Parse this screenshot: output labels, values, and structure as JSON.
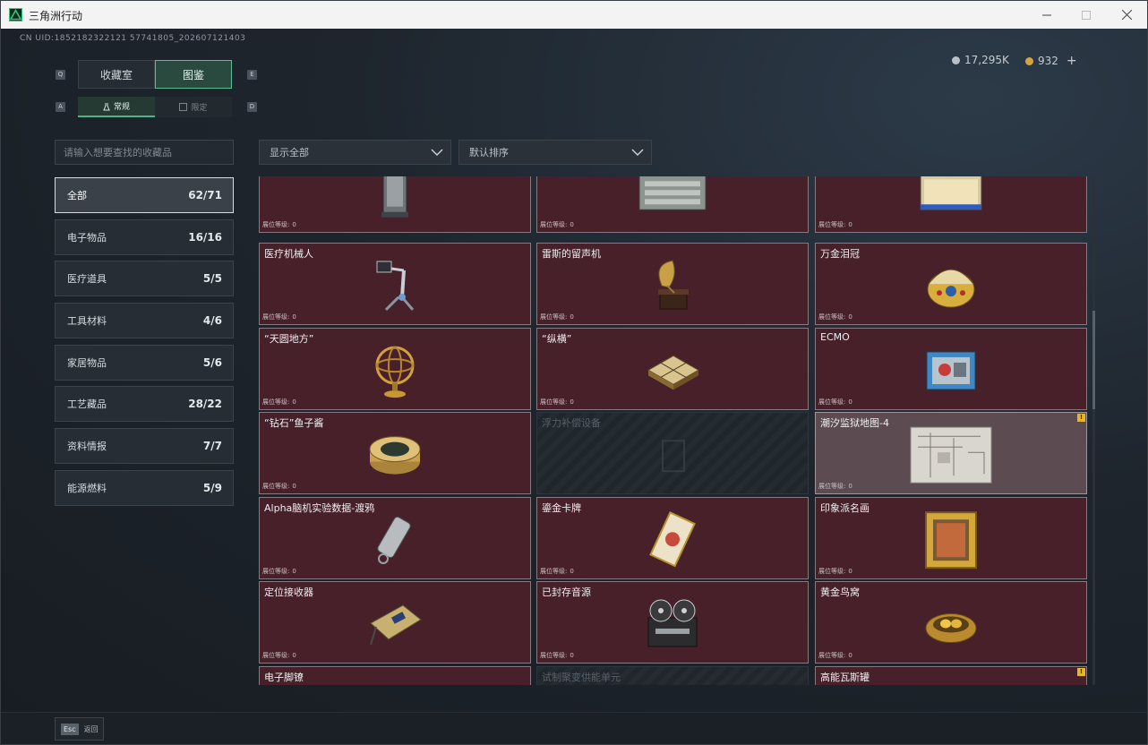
{
  "window": {
    "title": "三角洲行动"
  },
  "header": {
    "uid": "CN UID:1852182322121 57741805_202607121403",
    "currency_a": "17,295K",
    "currency_b": "932",
    "add_label": "+"
  },
  "tabs": {
    "left_key": "Q",
    "right_key": "E",
    "items": [
      {
        "label": "收藏室"
      },
      {
        "label": "图鉴"
      }
    ]
  },
  "subtabs": {
    "left_key": "A",
    "right_key": "D",
    "items": [
      {
        "label": "常规"
      },
      {
        "label": "限定"
      }
    ]
  },
  "search": {
    "placeholder": "请输入想要查找的收藏品"
  },
  "filters": {
    "show": "显示全部",
    "sort": "默认排序"
  },
  "categories": [
    {
      "label": "全部",
      "count": "62/71"
    },
    {
      "label": "电子物品",
      "count": "16/16"
    },
    {
      "label": "医疗道具",
      "count": "5/5"
    },
    {
      "label": "工具材料",
      "count": "4/6"
    },
    {
      "label": "家居物品",
      "count": "5/6"
    },
    {
      "label": "工艺藏品",
      "count": "28/22"
    },
    {
      "label": "资料情报",
      "count": "7/7"
    },
    {
      "label": "能源燃料",
      "count": "5/9"
    }
  ],
  "level_label": "展位等级:",
  "items": [
    {
      "name": "",
      "level": "0",
      "icon": "machine-icon"
    },
    {
      "name": "",
      "level": "0",
      "icon": "crate-icon"
    },
    {
      "name": "",
      "level": "0",
      "icon": "battery-pack-icon"
    },
    {
      "name": "医疗机械人",
      "level": "0",
      "icon": "medical-robot-icon"
    },
    {
      "name": "雷斯的留声机",
      "level": "0",
      "icon": "gramophone-icon"
    },
    {
      "name": "万金泪冠",
      "level": "0",
      "icon": "jeweled-egg-icon"
    },
    {
      "name": "“天圆地方”",
      "level": "0",
      "icon": "armillary-sphere-icon"
    },
    {
      "name": "“纵横”",
      "level": "0",
      "icon": "chessboard-icon"
    },
    {
      "name": "ECMO",
      "level": "0",
      "icon": "ecmo-machine-icon"
    },
    {
      "name": "“钻石”鱼子酱",
      "level": "0",
      "icon": "caviar-tin-icon"
    },
    {
      "name": "浮力补偿设备",
      "level": "",
      "icon": "locked-item-icon"
    },
    {
      "name": "潮汐监狱地图-4",
      "level": "0",
      "icon": "map-icon"
    },
    {
      "name": "Alpha脑机实验数据-渡鸦",
      "level": "0",
      "icon": "data-drive-icon"
    },
    {
      "name": "鎏金卡牌",
      "level": "0",
      "icon": "gilded-card-icon"
    },
    {
      "name": "印象派名画",
      "level": "0",
      "icon": "framed-painting-icon"
    },
    {
      "name": "定位接收器",
      "level": "0",
      "icon": "gps-receiver-icon"
    },
    {
      "name": "已封存音源",
      "level": "0",
      "icon": "reel-recorder-icon"
    },
    {
      "name": "黄金鸟窝",
      "level": "0",
      "icon": "golden-nest-icon"
    },
    {
      "name": "电子脚镣",
      "level": "",
      "icon": "ankle-monitor-icon"
    },
    {
      "name": "试制聚变供能单元",
      "level": "",
      "icon": "locked-item-icon"
    },
    {
      "name": "高能瓦斯罐",
      "level": "",
      "icon": "gas-canister-icon"
    }
  ],
  "warning_badge": "!",
  "footer": {
    "esc_key": "Esc",
    "back_label": "返回"
  },
  "colors": {
    "accent": "#4fb587",
    "card_bg": "#47202a",
    "gold": "#d4a53c"
  }
}
